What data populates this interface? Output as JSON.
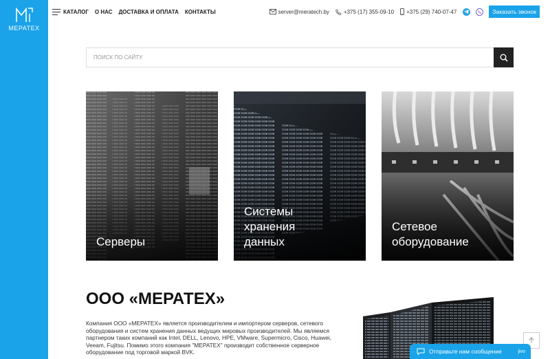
{
  "brand": {
    "logo_text": "MEPATEX"
  },
  "nav": {
    "menu_label": "Каталог",
    "links": [
      "О нас",
      "Доставка и оплата",
      "Контакты"
    ]
  },
  "contacts": {
    "email": "server@meratech.by",
    "phone1": "+375 (17) 355-09-10",
    "phone2": "+375 (29) 740-07-47",
    "callback_label": "Заказать звонок"
  },
  "search": {
    "placeholder": "Поиск по сайту"
  },
  "categories": [
    {
      "lines": [
        "Серверы"
      ]
    },
    {
      "lines": [
        "Системы",
        "хранения",
        "данных"
      ]
    },
    {
      "lines": [
        "Сетевое",
        "оборудование"
      ]
    }
  ],
  "company": {
    "title": "ООО «МЕРАТЕХ»",
    "text": "Компания ООО «МЕРАТЕХ» является производителем и импортером серверов, сетевого оборудования и систем хранения данных ведущих мировых производителей. Мы являемся партнером таких компаний как Intel, DELL, Lenovo, HPE, VMware, Supermicro, Cisco, Huawei, Veeam, Fujitsu. Помимо этого компания \"МЕРАТЕХ\" производит собственное серверное оборудование под торговой маркой BVK."
  },
  "chat": {
    "label": "Отправьте нам сообщение",
    "brand": "jivo"
  },
  "colors": {
    "accent": "#1aa3e8",
    "dark": "#222222"
  },
  "icons": [
    "menu-icon",
    "mail-icon",
    "phone-icon",
    "mobile-icon",
    "telegram-icon",
    "viber-icon",
    "search-icon",
    "arrow-up-icon",
    "chat-icon"
  ]
}
